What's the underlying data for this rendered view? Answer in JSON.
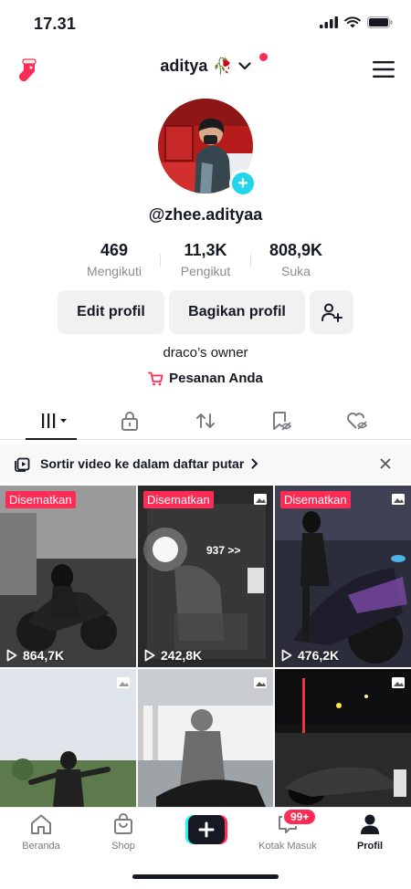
{
  "status_bar": {
    "time": "17.31"
  },
  "header": {
    "username": "aditya",
    "username_emoji": "🥀"
  },
  "profile": {
    "handle": "@zhee.adityaa",
    "stats": [
      {
        "value": "469",
        "label": "Mengikuti"
      },
      {
        "value": "11,3K",
        "label": "Pengikut"
      },
      {
        "value": "808,9K",
        "label": "Suka"
      }
    ],
    "buttons": {
      "edit": "Edit profil",
      "share": "Bagikan profil"
    },
    "bio": "draco’s owner",
    "orders_label": "Pesanan Anda"
  },
  "playlist_bar": {
    "text": "Sortir video ke dalam daftar putar"
  },
  "videos": [
    {
      "pinned": "Disematkan",
      "views": "864,7K"
    },
    {
      "pinned": "Disematkan",
      "views": "242,8K",
      "overlay_text": "937 >>"
    },
    {
      "pinned": "Disematkan",
      "views": "476,2K"
    },
    {},
    {},
    {}
  ],
  "bottom_nav": {
    "home": "Beranda",
    "shop": "Shop",
    "inbox": "Kotak Masuk",
    "inbox_badge": "99+",
    "profile": "Profil"
  },
  "colors": {
    "accent": "#fe2c55",
    "cyan": "#20d5ec",
    "text": "#161823",
    "muted": "#8a8b91"
  }
}
